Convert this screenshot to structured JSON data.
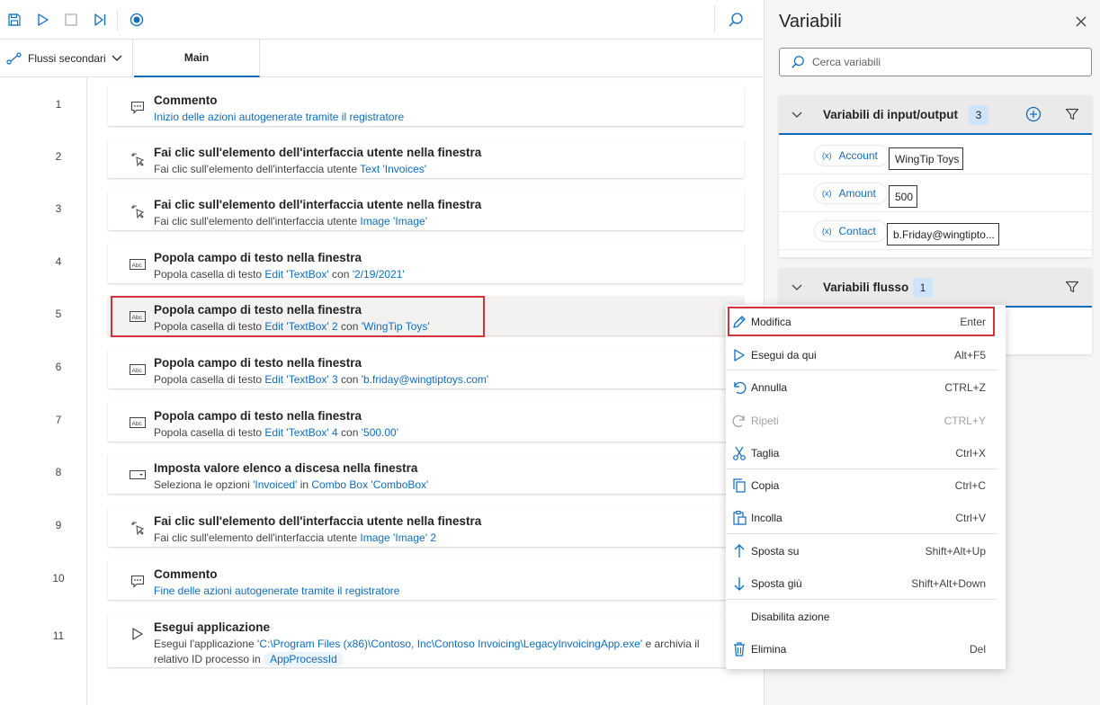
{
  "toolbar": {
    "icons": [
      "save-icon",
      "run-icon",
      "stop-icon",
      "run-next-action-icon",
      "recorder-icon",
      "search-icon"
    ]
  },
  "tabs": {
    "subflows_label": "Flussi secondari",
    "main_label": "Main"
  },
  "actions": [
    {
      "num": "1",
      "icon": "comment-icon",
      "title": "Commento",
      "desc": [
        {
          "t": "Inizio delle azioni autogenerate tramite il registratore",
          "link": true
        }
      ]
    },
    {
      "num": "2",
      "icon": "click-element-icon",
      "title": "Fai clic sull'elemento dell'interfaccia utente nella finestra",
      "desc": [
        {
          "t": "Fai clic sull'elemento dell'interfaccia utente "
        },
        {
          "t": "Text 'Invoices'",
          "link": true
        }
      ]
    },
    {
      "num": "3",
      "icon": "click-element-icon",
      "title": "Fai clic sull'elemento dell'interfaccia utente nella finestra",
      "desc": [
        {
          "t": "Fai clic sull'elemento dell'interfaccia utente "
        },
        {
          "t": "Image 'Image'",
          "link": true
        }
      ]
    },
    {
      "num": "4",
      "icon": "textbox-icon",
      "title": "Popola campo di testo nella finestra",
      "desc": [
        {
          "t": "Popola casella di testo "
        },
        {
          "t": "Edit 'TextBox'",
          "link": true
        },
        {
          "t": " con "
        },
        {
          "t": "'2/19/2021'",
          "link": true
        }
      ]
    },
    {
      "num": "5",
      "icon": "textbox-icon",
      "title": "Popola campo di testo nella finestra",
      "desc": [
        {
          "t": "Popola casella di testo "
        },
        {
          "t": "Edit 'TextBox' 2",
          "link": true
        },
        {
          "t": " con "
        },
        {
          "t": "'WingTip Toys'",
          "link": true
        }
      ]
    },
    {
      "num": "6",
      "icon": "textbox-icon",
      "title": "Popola campo di testo nella finestra",
      "desc": [
        {
          "t": "Popola casella di testo "
        },
        {
          "t": "Edit 'TextBox' 3",
          "link": true
        },
        {
          "t": " con "
        },
        {
          "t": "'b.friday@wingtiptoys.com'",
          "link": true
        }
      ]
    },
    {
      "num": "7",
      "icon": "textbox-icon",
      "title": "Popola campo di testo nella finestra",
      "desc": [
        {
          "t": "Popola casella di testo "
        },
        {
          "t": "Edit 'TextBox' 4",
          "link": true
        },
        {
          "t": " con "
        },
        {
          "t": "'500.00'",
          "link": true
        }
      ]
    },
    {
      "num": "8",
      "icon": "dropdown-icon",
      "title": "Imposta valore elenco a discesa nella finestra",
      "desc": [
        {
          "t": "Seleziona le opzioni "
        },
        {
          "t": "'Invoiced'",
          "link": true
        },
        {
          "t": " in "
        },
        {
          "t": "Combo Box 'ComboBox'",
          "link": true
        }
      ]
    },
    {
      "num": "9",
      "icon": "click-element-icon",
      "title": "Fai clic sull'elemento dell'interfaccia utente nella finestra",
      "desc": [
        {
          "t": "Fai clic sull'elemento dell'interfaccia utente "
        },
        {
          "t": "Image 'Image' 2",
          "link": true
        }
      ]
    },
    {
      "num": "10",
      "icon": "comment-icon",
      "title": "Commento",
      "desc": [
        {
          "t": "Fine delle azioni autogenerate tramite il registratore",
          "link": true
        }
      ]
    },
    {
      "num": "11",
      "icon": "run-application-icon",
      "title": "Esegui applicazione",
      "desc": [
        {
          "t": "Esegui l'applicazione "
        },
        {
          "t": "'C:\\Program Files (x86)\\Contoso, Inc\\Contoso Invoicing\\LegacyInvoicingApp.exe'",
          "link": true
        },
        {
          "t": " e archivia il"
        }
      ],
      "desc2": [
        {
          "t": "relativo ID processo in "
        },
        {
          "t": "AppProcessId",
          "pill": true
        }
      ]
    }
  ],
  "variables": {
    "title": "Variabili",
    "search_placeholder": "Cerca variabili",
    "io_section": {
      "name": "Variabili di input/output",
      "count": "3",
      "items": [
        {
          "name": "Account",
          "value": "WingTip Toys"
        },
        {
          "name": "Amount",
          "value": "500"
        },
        {
          "name": "Contact",
          "value": "b.Friday@wingtipto..."
        }
      ]
    },
    "flow_section": {
      "name": "Variabili flusso",
      "count": "1"
    }
  },
  "context_menu": {
    "items": [
      {
        "icon": "edit-icon",
        "label": "Modifica",
        "shortcut": "Enter",
        "disabled": false
      },
      {
        "icon": "run-from-here-icon",
        "label": "Esegui da qui",
        "shortcut": "Alt+F5",
        "disabled": false
      },
      {
        "icon": "undo-icon",
        "label": "Annulla",
        "shortcut": "CTRL+Z",
        "disabled": false
      },
      {
        "icon": "redo-icon",
        "label": "Ripeti",
        "shortcut": "CTRL+Y",
        "disabled": true
      },
      {
        "icon": "cut-icon",
        "label": "Taglia",
        "shortcut": "Ctrl+X",
        "disabled": false
      },
      {
        "icon": "copy-icon",
        "label": "Copia",
        "shortcut": "Ctrl+C",
        "disabled": false
      },
      {
        "icon": "paste-icon",
        "label": "Incolla",
        "shortcut": "Ctrl+V",
        "disabled": false
      },
      {
        "icon": "move-up-icon",
        "label": "Sposta su",
        "shortcut": "Shift+Alt+Up",
        "disabled": false
      },
      {
        "icon": "move-down-icon",
        "label": "Sposta giù",
        "shortcut": "Shift+Alt+Down",
        "disabled": false
      },
      {
        "icon": "",
        "label": "Disabilita azione",
        "shortcut": "",
        "disabled": false
      },
      {
        "icon": "delete-icon",
        "label": "Elimina",
        "shortcut": "Del",
        "disabled": false
      }
    ]
  },
  "colors": {
    "accent": "#0f6cbd",
    "highlight_outline": "#d13438"
  }
}
